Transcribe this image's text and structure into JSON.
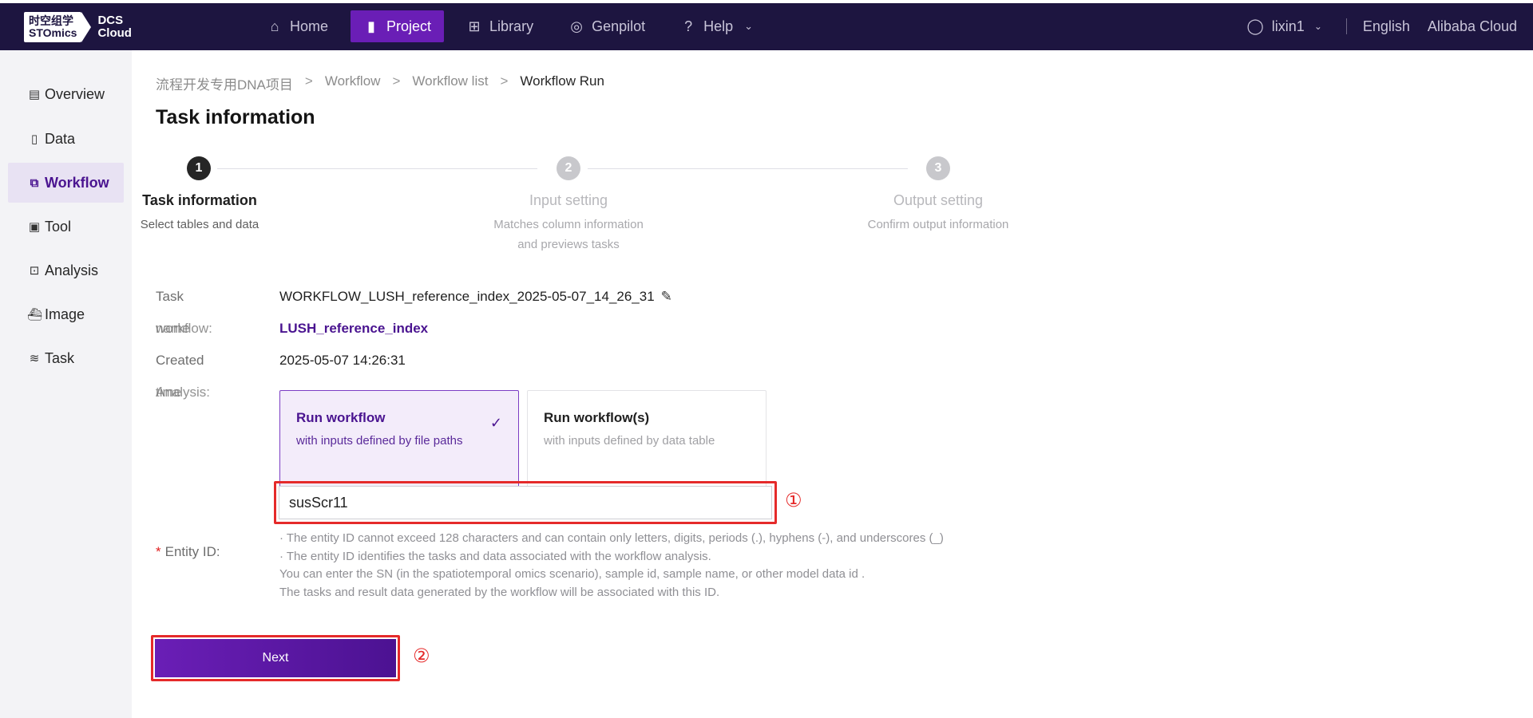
{
  "header": {
    "logo": {
      "line1": "时空组学",
      "line2": "STOmics",
      "product_line1": "DCS",
      "product_line2": "Cloud"
    },
    "nav": [
      {
        "label": "Home",
        "icon": "home-icon",
        "active": false
      },
      {
        "label": "Project",
        "icon": "document-icon",
        "active": true
      },
      {
        "label": "Library",
        "icon": "grid-icon",
        "active": false
      },
      {
        "label": "Genpilot",
        "icon": "aperture-icon",
        "active": false
      },
      {
        "label": "Help",
        "icon": "question-icon",
        "active": false
      }
    ],
    "user": "lixin1",
    "language": "English",
    "cloud": "Alibaba Cloud"
  },
  "sidebar": {
    "items": [
      {
        "label": "Overview",
        "icon": "document-icon",
        "active": false
      },
      {
        "label": "Data",
        "icon": "file-icon",
        "active": false
      },
      {
        "label": "Workflow",
        "icon": "workflow-icon",
        "active": true
      },
      {
        "label": "Tool",
        "icon": "image-frame-icon",
        "active": false
      },
      {
        "label": "Analysis",
        "icon": "code-icon",
        "active": false
      },
      {
        "label": "Image",
        "icon": "docker-icon",
        "active": false
      },
      {
        "label": "Task",
        "icon": "layers-icon",
        "active": false
      }
    ]
  },
  "breadcrumb": {
    "items": [
      "流程开发专用DNA项目",
      "Workflow",
      "Workflow list",
      "Workflow Run"
    ],
    "separator": ">"
  },
  "page_title": "Task information",
  "steps": [
    {
      "number": "1",
      "title": "Task information",
      "desc_line1": "Select tables and data",
      "desc_line2": "",
      "active": true
    },
    {
      "number": "2",
      "title": "Input setting",
      "desc_line1": "Matches column information",
      "desc_line2": "and previews tasks",
      "active": false
    },
    {
      "number": "3",
      "title": "Output setting",
      "desc_line1": "Confirm output information",
      "desc_line2": "",
      "active": false
    }
  ],
  "form": {
    "task_label": "Task",
    "task_value": "WORKFLOW_LUSH_reference_index_2025-05-07_14_26_31",
    "workflow_label_a": "name",
    "workflow_label_b": "workflow:",
    "workflow_value": "LUSH_reference_index",
    "created_label": "Created",
    "created_value": "2025-05-07 14:26:31",
    "analysis_label_a": "time",
    "analysis_label_b": "Analysis:",
    "cards": [
      {
        "title": "Run workflow",
        "sub": "with inputs defined by file paths",
        "selected": true
      },
      {
        "title": "Run workflow(s)",
        "sub": "with inputs defined by data table",
        "selected": false
      }
    ],
    "entity_label": "Entity  ID:",
    "entity_required": "*",
    "entity_value": "susScr11",
    "hints": [
      "· The entity ID cannot exceed 128 characters and can contain only letters, digits, periods (.), hyphens (-), and underscores (_)",
      "· The entity ID identifies the tasks and data associated with the workflow analysis.",
      "You can enter the SN (in the spatiotemporal omics scenario), sample id, sample name, or other model data id .",
      "The tasks and result data generated by the workflow will be associated with this ID."
    ],
    "next_label": "Next"
  },
  "annotations": {
    "first": "①",
    "second": "②"
  },
  "colors": {
    "topbar": "#1d1540",
    "accent": "#6a1eb6",
    "highlight": "#e52a2a"
  }
}
